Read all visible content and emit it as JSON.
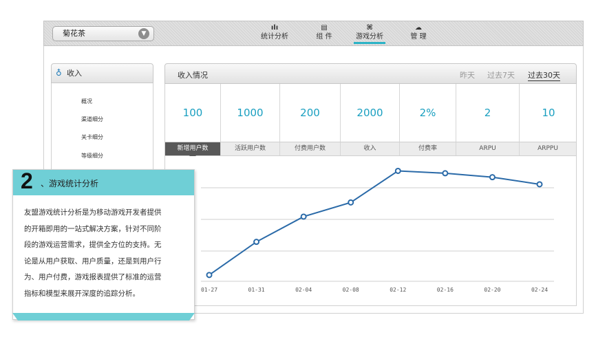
{
  "topbar": {
    "app_select": "菊花茶",
    "app_select_icon": "chevron-down-icon",
    "nav": [
      {
        "label": "统计分析",
        "icon": "bar-chart-icon",
        "glyph": "ılı",
        "active": false
      },
      {
        "label": "组 件",
        "icon": "component-icon",
        "glyph": "▤",
        "active": false
      },
      {
        "label": "游戏分析",
        "icon": "gamepad-icon",
        "glyph": "⌘",
        "active": true
      },
      {
        "label": "管 理",
        "icon": "cloud-gear-icon",
        "glyph": "☁",
        "active": false
      }
    ]
  },
  "sidebar": {
    "title": "收入",
    "title_icon": "money-bag-icon",
    "items": [
      "概况",
      "渠道细分",
      "关卡细分",
      "等级细分"
    ]
  },
  "income": {
    "title": "收入情况",
    "ranges": [
      {
        "label": "昨天",
        "active": false
      },
      {
        "label": "过去7天",
        "active": false
      },
      {
        "label": "过去30天",
        "active": true
      }
    ],
    "metrics": [
      {
        "value": "100",
        "label": "新增用户数",
        "active": true
      },
      {
        "value": "1000",
        "label": "活跃用户数",
        "active": false
      },
      {
        "value": "200",
        "label": "付费用户数",
        "active": false
      },
      {
        "value": "2000",
        "label": "收入",
        "active": false
      },
      {
        "value": "2%",
        "label": "付费率",
        "active": false
      },
      {
        "value": "2",
        "label": "ARPU",
        "active": false
      },
      {
        "value": "10",
        "label": "ARPPU",
        "active": false
      }
    ]
  },
  "chart_data": {
    "type": "line",
    "x": [
      "01-27",
      "01-31",
      "02-04",
      "02-08",
      "02-12",
      "02-16",
      "02-20",
      "02-24"
    ],
    "series": [
      {
        "values": [
          4,
          25,
          41,
          50,
          70,
          68.5,
          66,
          61.5
        ]
      }
    ],
    "ylim": [
      0,
      75
    ],
    "grid": true,
    "color": "#2a6aa8"
  },
  "card": {
    "number": "2",
    "title": "、游戏统计分析",
    "lines": [
      "友盟游戏统计分析是为移动游戏开发者提供",
      "的开箱即用的一站式解决方案，针对不同阶",
      "段的游戏运营需求，提供全方位的支持。无",
      "论是从用户获取、用户质量，还是到用户行",
      "为、用户付费，游戏报表提供了标准的运营",
      "指标和模型来展开深度的追踪分析。"
    ],
    "accent": "#6fcfd6"
  }
}
